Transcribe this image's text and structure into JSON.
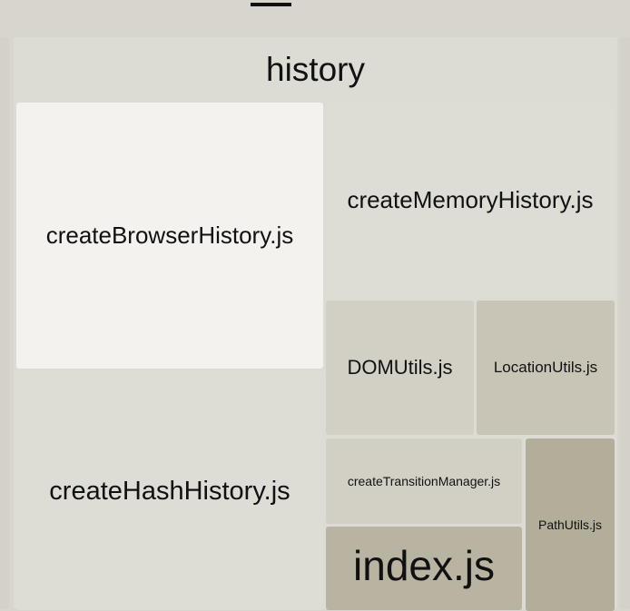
{
  "treemap": {
    "group": {
      "label": "history"
    },
    "files": {
      "create_browser_history": "createBrowserHistory.js",
      "create_memory_history": "createMemoryHistory.js",
      "dom_utils": "DOMUtils.js",
      "location_utils": "LocationUtils.js",
      "create_hash_history": "createHashHistory.js",
      "create_transition_manager": "createTransitionManager.js",
      "path_utils": "PathUtils.js",
      "index": "index.js"
    }
  },
  "colors": {
    "background": "#d8d6cc",
    "group": "#dcdbd4",
    "highlight": "#f3f2ef",
    "light": "#dddcd5",
    "medium": "#d2d0c4",
    "medium_dark": "#c8c5b6",
    "dark": "#b3ae9a",
    "darker": "#b9b4a2"
  }
}
